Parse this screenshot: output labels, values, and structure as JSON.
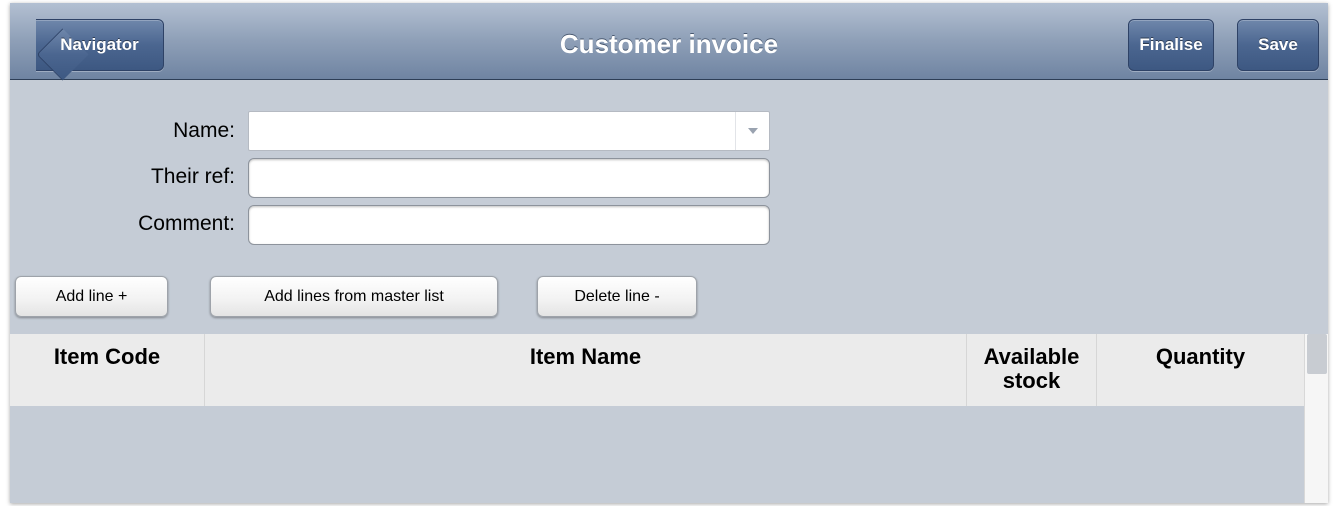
{
  "navbar": {
    "title": "Customer invoice",
    "back_label": "Navigator",
    "finalise_label": "Finalise",
    "save_label": "Save"
  },
  "form": {
    "name_label": "Name:",
    "name_value": "",
    "their_ref_label": "Their ref:",
    "their_ref_value": "",
    "comment_label": "Comment:",
    "comment_value": ""
  },
  "actions": {
    "add_line_label": "Add line +",
    "add_master_label": "Add lines from master list",
    "delete_line_label": "Delete line -"
  },
  "table": {
    "columns": [
      "Item Code",
      "Item Name",
      "Available stock",
      "Quantity"
    ],
    "rows": []
  },
  "colors": {
    "navbar": "#8e9fb7",
    "nav_button": "#4b6690",
    "background": "#c5ccd6",
    "table_header": "#ebebeb"
  }
}
